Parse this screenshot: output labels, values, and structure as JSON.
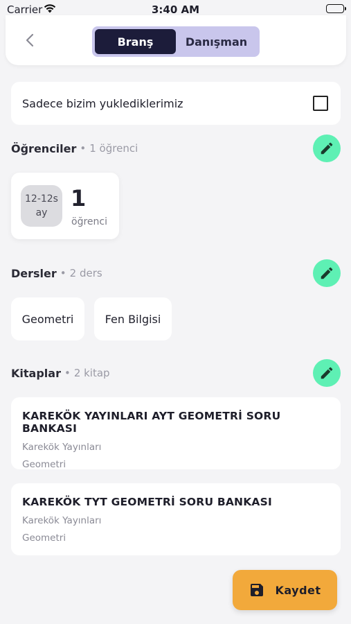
{
  "status_bar": {
    "carrier": "Carrier",
    "time": "3:40 AM"
  },
  "header": {
    "tabs": [
      {
        "label": "Branş",
        "active": true
      },
      {
        "label": "Danışman",
        "active": false
      }
    ]
  },
  "filter": {
    "label": "Sadece bizim yuklediklerimiz",
    "checked": false
  },
  "students": {
    "title": "Öğrenciler",
    "separator": "•",
    "count_text": "1 öğrenci",
    "card": {
      "age_line1": "12-12s",
      "age_line2": "ay",
      "count": "1",
      "unit": "öğrenci"
    }
  },
  "lessons": {
    "title": "Dersler",
    "separator": "•",
    "count_text": "2 ders",
    "items": [
      "Geometri",
      "Fen Bilgisi"
    ]
  },
  "books": {
    "title": "Kitaplar",
    "separator": "•",
    "count_text": "2 kitap",
    "items": [
      {
        "title": "KAREKÖK YAYINLARI AYT GEOMETRİ SORU BANKASI",
        "publisher": "Karekök Yayınları",
        "subject": "Geometri"
      },
      {
        "title": "KAREKÖK TYT GEOMETRİ SORU BANKASI",
        "publisher": "Karekök Yayınları",
        "subject": "Geometri"
      }
    ]
  },
  "save_button": {
    "label": "Kaydet"
  },
  "colors": {
    "accent_green": "#5ef0b4",
    "save_orange": "#f2a93b",
    "segment_active": "#1c1c3a",
    "segment_bg": "#c9c6ec"
  },
  "icons": {
    "back": "chevron-left-icon",
    "edit": "pencil-icon",
    "save": "floppy-disk-icon",
    "wifi": "wifi-icon",
    "battery": "battery-icon"
  }
}
